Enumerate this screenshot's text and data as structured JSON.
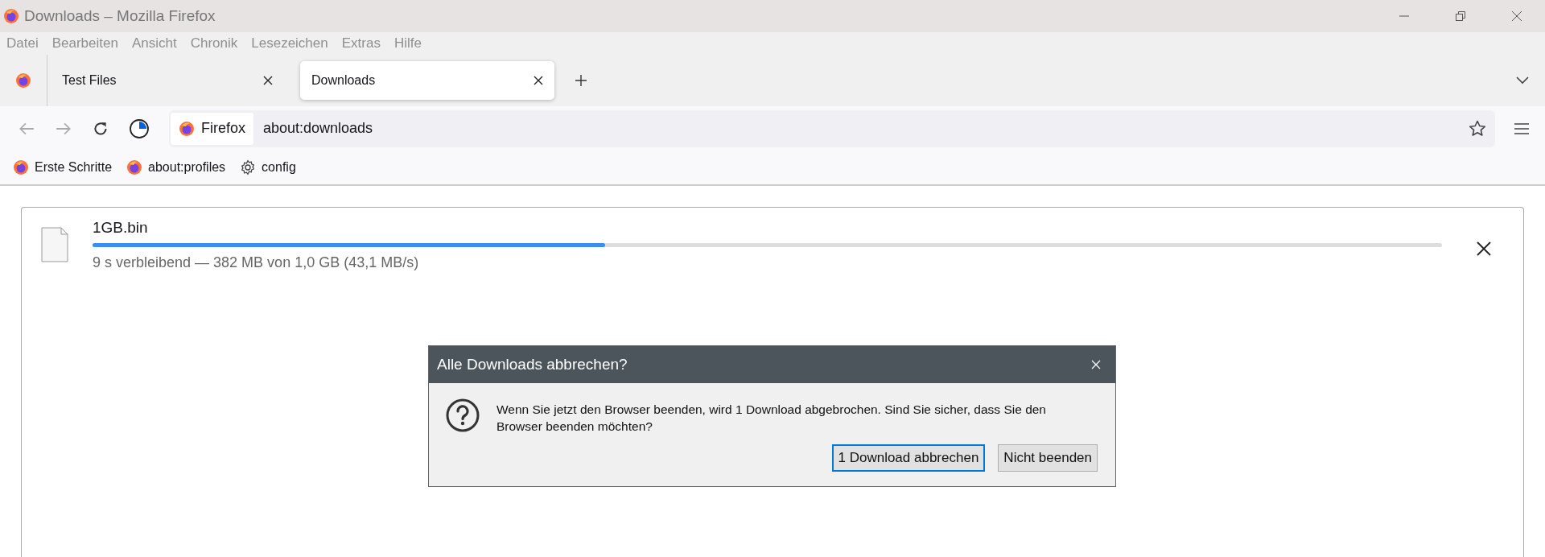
{
  "window": {
    "title": "Downloads – Mozilla Firefox"
  },
  "menu": [
    "Datei",
    "Bearbeiten",
    "Ansicht",
    "Chronik",
    "Lesezeichen",
    "Extras",
    "Hilfe"
  ],
  "tabs": [
    {
      "kind": "pinned",
      "selected": false
    },
    {
      "kind": "normal",
      "label": "Test Files",
      "selected": false
    },
    {
      "kind": "normal",
      "label": "Downloads",
      "selected": true
    }
  ],
  "address_bar": {
    "identity": "Firefox",
    "url": "about:downloads"
  },
  "bookmarks": [
    {
      "kind": "firefox",
      "label": "Erste Schritte"
    },
    {
      "kind": "firefox",
      "label": "about:profiles"
    },
    {
      "kind": "gear",
      "label": "config"
    }
  ],
  "downloads": [
    {
      "name": "1GB.bin",
      "level": 0.38,
      "status": "9 s verbleibend — 382 MB von 1,0 GB (43,1 MB/s)"
    }
  ],
  "dialog": {
    "title": "Alle Downloads abbrechen?",
    "message": "Wenn Sie jetzt den Browser beenden, wird 1 Download abgebrochen. Sind Sie sicher, dass Sie den Browser beenden möchten?",
    "buttons": [
      {
        "label": "1 Download abbrechen",
        "default": true
      },
      {
        "label": "Nicht beenden",
        "default": false
      }
    ]
  }
}
